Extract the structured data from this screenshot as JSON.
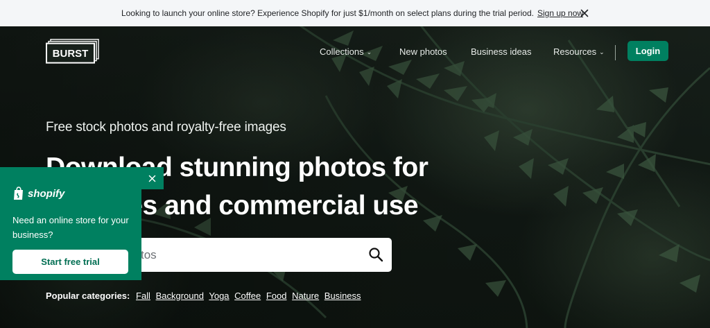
{
  "announcement": {
    "message": "Looking to launch your online store? Experience Shopify for just $1/month on select plans during the trial period.",
    "signup_label": "Sign up now"
  },
  "header": {
    "logo_text": "BURST",
    "nav": {
      "collections": "Collections",
      "new_photos": "New photos",
      "business_ideas": "Business ideas",
      "resources": "Resources"
    },
    "login_label": "Login"
  },
  "hero": {
    "subtitle": "Free stock photos and royalty-free images",
    "headline": "Download stunning photos for websites and commercial use",
    "search_placeholder": "Search free photos",
    "popular_label": "Popular categories:",
    "categories": [
      "Fall",
      "Background",
      "Yoga",
      "Coffee",
      "Food",
      "Nature",
      "Business"
    ]
  },
  "promo": {
    "brand": "shopify",
    "text": "Need an online store for your business?",
    "cta_label": "Start free trial"
  },
  "colors": {
    "accent": "#008060",
    "announcement_bg": "#f4f6f8"
  },
  "icons": [
    "close-icon",
    "burst-logo",
    "chevron-down-icon",
    "search-icon",
    "shopify-bag-icon"
  ]
}
